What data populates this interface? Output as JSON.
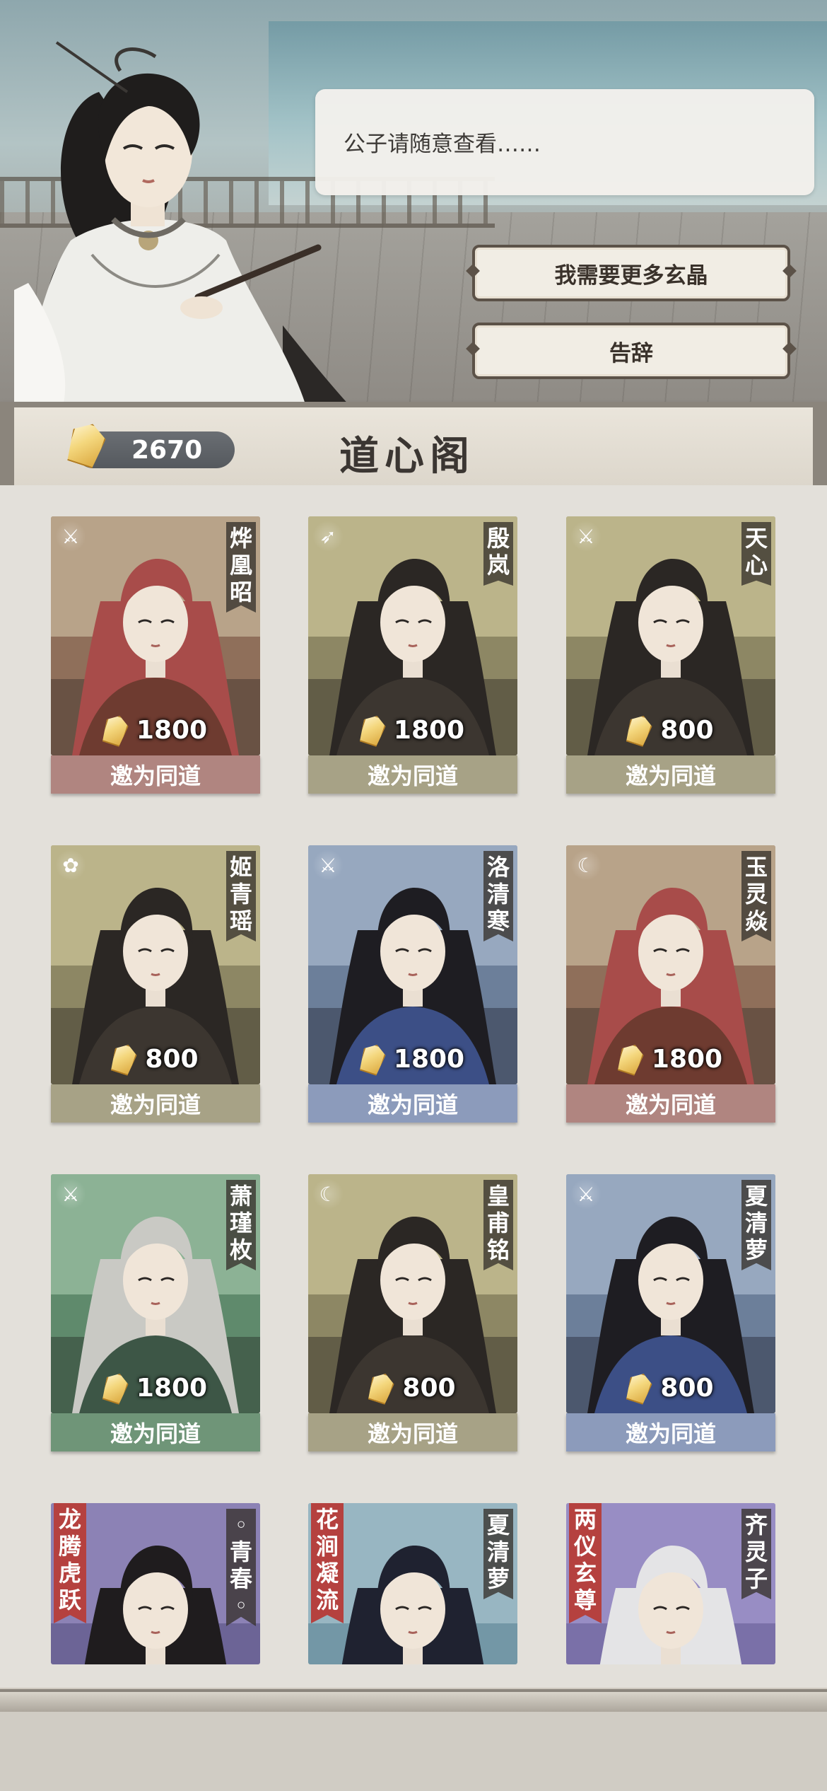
{
  "dialog": {
    "text": "公子请随意查看……",
    "options": [
      "我需要更多玄晶",
      "告辞"
    ]
  },
  "header": {
    "currency_amount": "2670",
    "title": "道心阁"
  },
  "icon_names": [
    "crystal-icon",
    "sword-icon",
    "spear-icon",
    "flower-staff-icon",
    "moon-icon"
  ],
  "colors": {
    "invite_red": "#b08580",
    "invite_olive": "#a7a286",
    "invite_blue": "#8c9bbb",
    "invite_green": "#6f9578",
    "tag_red": "#b5413f"
  },
  "cards": [
    {
      "name": "烨凰昭",
      "cost": "1800",
      "button": "邀为同道",
      "weapon": "sword",
      "theme": "red"
    },
    {
      "name": "殷岚",
      "cost": "1800",
      "button": "邀为同道",
      "weapon": "spear",
      "theme": "olive"
    },
    {
      "name": "天心",
      "cost": "800",
      "button": "邀为同道",
      "weapon": "sword",
      "theme": "olive"
    },
    {
      "name": "姬青瑶",
      "cost": "800",
      "button": "邀为同道",
      "weapon": "flower",
      "theme": "olive"
    },
    {
      "name": "洛清寒",
      "cost": "1800",
      "button": "邀为同道",
      "weapon": "sword",
      "theme": "blue"
    },
    {
      "name": "玉灵焱",
      "cost": "1800",
      "button": "邀为同道",
      "weapon": "moon",
      "theme": "red"
    },
    {
      "name": "萧瑾枚",
      "cost": "1800",
      "button": "邀为同道",
      "weapon": "sword",
      "theme": "green"
    },
    {
      "name": "皇甫铭",
      "cost": "800",
      "button": "邀为同道",
      "weapon": "moon",
      "theme": "olive"
    },
    {
      "name": "夏清萝",
      "cost": "800",
      "button": "邀为同道",
      "weapon": "sword",
      "theme": "blue"
    }
  ],
  "skin_cards": [
    {
      "tag": "龙腾虎跃",
      "name": "◦青春◦"
    },
    {
      "tag": "花涧凝流",
      "name": "夏清萝"
    },
    {
      "tag": "两仪玄尊",
      "name": "齐灵子"
    }
  ]
}
